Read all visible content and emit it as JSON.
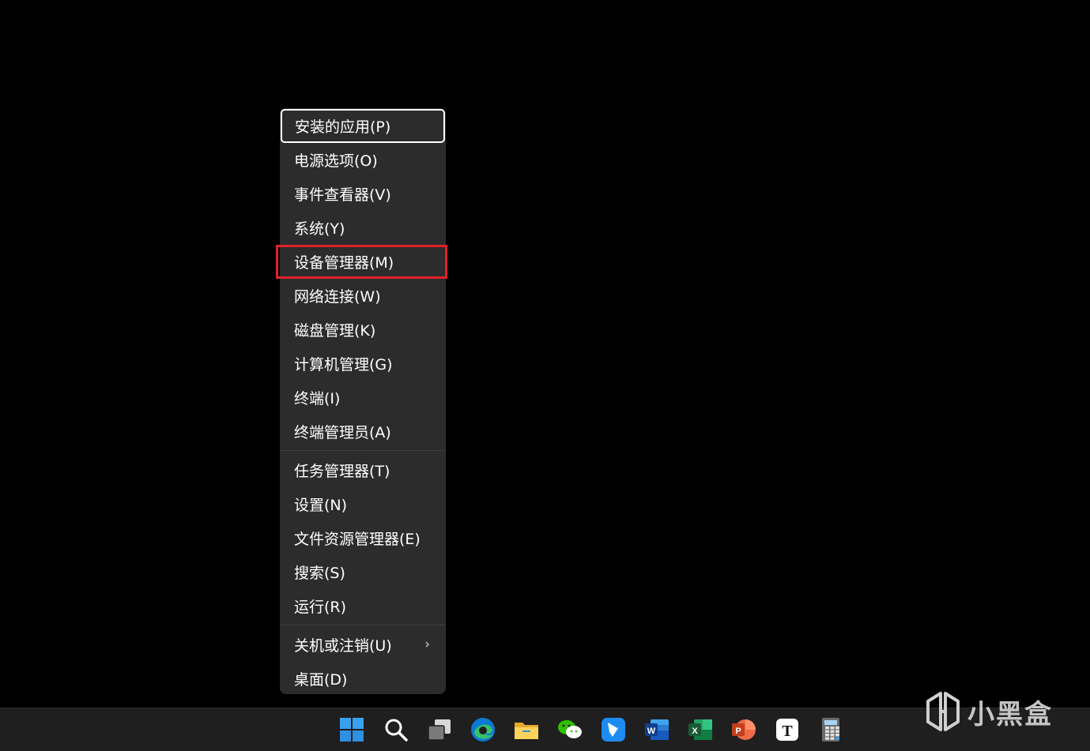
{
  "menu": {
    "groups": [
      [
        {
          "label": "安装的应用(P)",
          "state": "focused"
        },
        {
          "label": "电源选项(O)"
        },
        {
          "label": "事件查看器(V)"
        },
        {
          "label": "系统(Y)"
        },
        {
          "label": "设备管理器(M)",
          "state": "highlighted"
        },
        {
          "label": "网络连接(W)"
        },
        {
          "label": "磁盘管理(K)"
        },
        {
          "label": "计算机管理(G)"
        },
        {
          "label": "终端(I)"
        },
        {
          "label": "终端管理员(A)"
        }
      ],
      [
        {
          "label": "任务管理器(T)"
        },
        {
          "label": "设置(N)"
        },
        {
          "label": "文件资源管理器(E)"
        },
        {
          "label": "搜索(S)"
        },
        {
          "label": "运行(R)"
        }
      ],
      [
        {
          "label": "关机或注销(U)",
          "submenu": true
        },
        {
          "label": "桌面(D)"
        }
      ]
    ],
    "submenu_icon": "chevron-right-icon",
    "highlight_color": "#e0222a",
    "background_color": "#2c2c2c"
  },
  "taskbar": {
    "icons": [
      {
        "name": "windows-start-icon"
      },
      {
        "name": "search-icon"
      },
      {
        "name": "task-view-icon"
      },
      {
        "name": "edge-browser-icon"
      },
      {
        "name": "file-explorer-icon"
      },
      {
        "name": "wechat-icon"
      },
      {
        "name": "feishu-icon"
      },
      {
        "name": "word-icon",
        "letter": "W"
      },
      {
        "name": "excel-icon",
        "letter": "X"
      },
      {
        "name": "powerpoint-icon",
        "letter": "P"
      },
      {
        "name": "typora-icon",
        "letter": "T"
      },
      {
        "name": "calculator-icon"
      }
    ]
  },
  "watermark": {
    "text": "小黑盒",
    "logo": "xiaoheihe-logo-icon"
  }
}
